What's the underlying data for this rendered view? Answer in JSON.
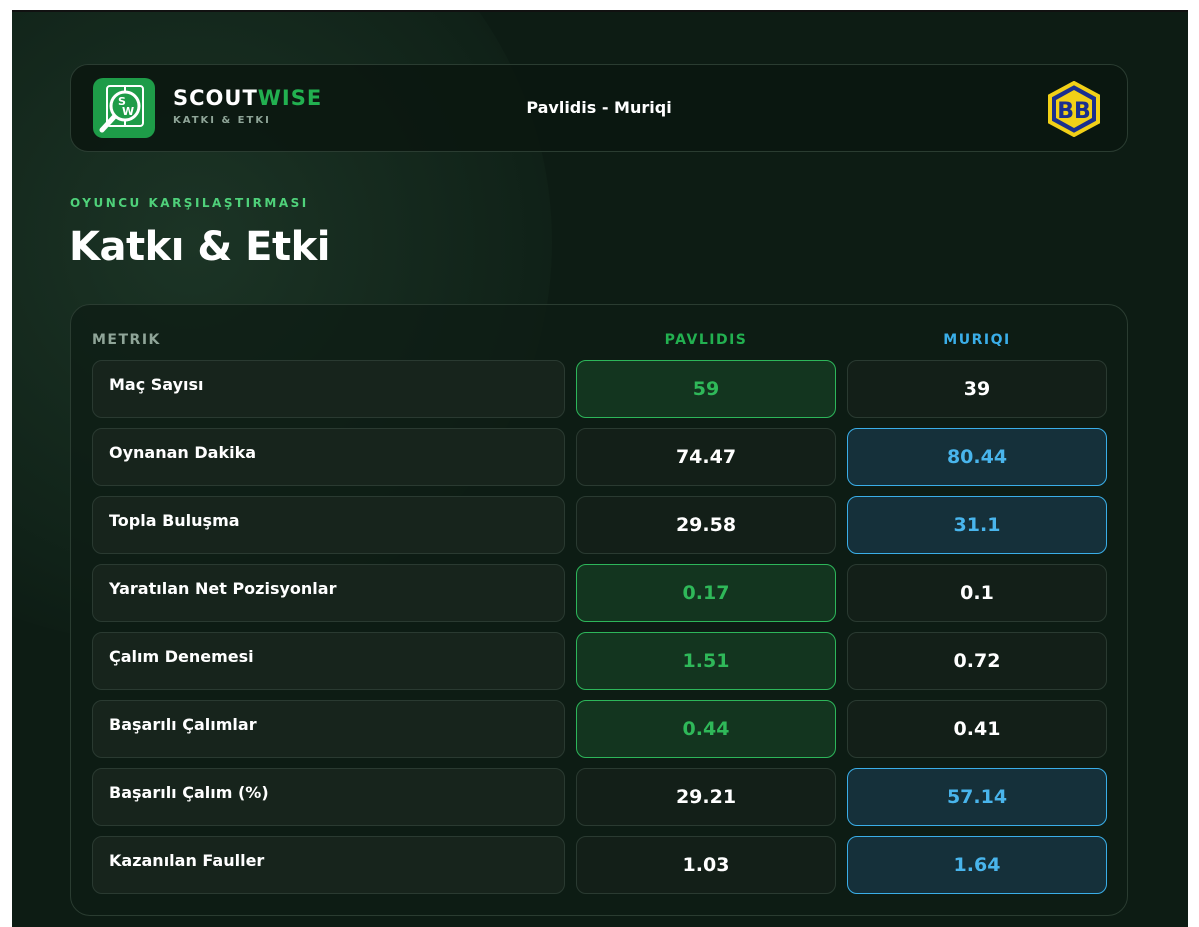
{
  "header": {
    "brand_primary": "SCOUT",
    "brand_accent": "WISE",
    "brand_subtitle": "KATKI & ETKI",
    "match_title": "Pavlidis - Muriqi",
    "logo_icon": "magnifier-field-icon",
    "club_badge_icon": "bb-club-badge-icon"
  },
  "section": {
    "eyebrow": "OYUNCU KARŞILAŞTIRMASI",
    "title": "Katkı & Etki"
  },
  "table": {
    "headers": {
      "metric": "METRIK",
      "player1": "PAVLIDIS",
      "player2": "MURIQI"
    },
    "rows": [
      {
        "metric": "Maç Sayısı",
        "p1": "59",
        "p2": "39",
        "winner": "p1"
      },
      {
        "metric": "Oynanan Dakika",
        "p1": "74.47",
        "p2": "80.44",
        "winner": "p2"
      },
      {
        "metric": "Topla Buluşma",
        "p1": "29.58",
        "p2": "31.1",
        "winner": "p2"
      },
      {
        "metric": "Yaratılan Net Pozisyonlar",
        "p1": "0.17",
        "p2": "0.1",
        "winner": "p1"
      },
      {
        "metric": "Çalım Denemesi",
        "p1": "1.51",
        "p2": "0.72",
        "winner": "p1"
      },
      {
        "metric": "Başarılı Çalımlar",
        "p1": "0.44",
        "p2": "0.41",
        "winner": "p1"
      },
      {
        "metric": "Başarılı Çalım (%)",
        "p1": "29.21",
        "p2": "57.14",
        "winner": "p2"
      },
      {
        "metric": "Kazanılan Fauller",
        "p1": "1.03",
        "p2": "1.64",
        "winner": "p2"
      }
    ]
  },
  "colors": {
    "background": "#0d1c14",
    "player1_accent": "#22b050",
    "player2_accent": "#3aaee8"
  }
}
